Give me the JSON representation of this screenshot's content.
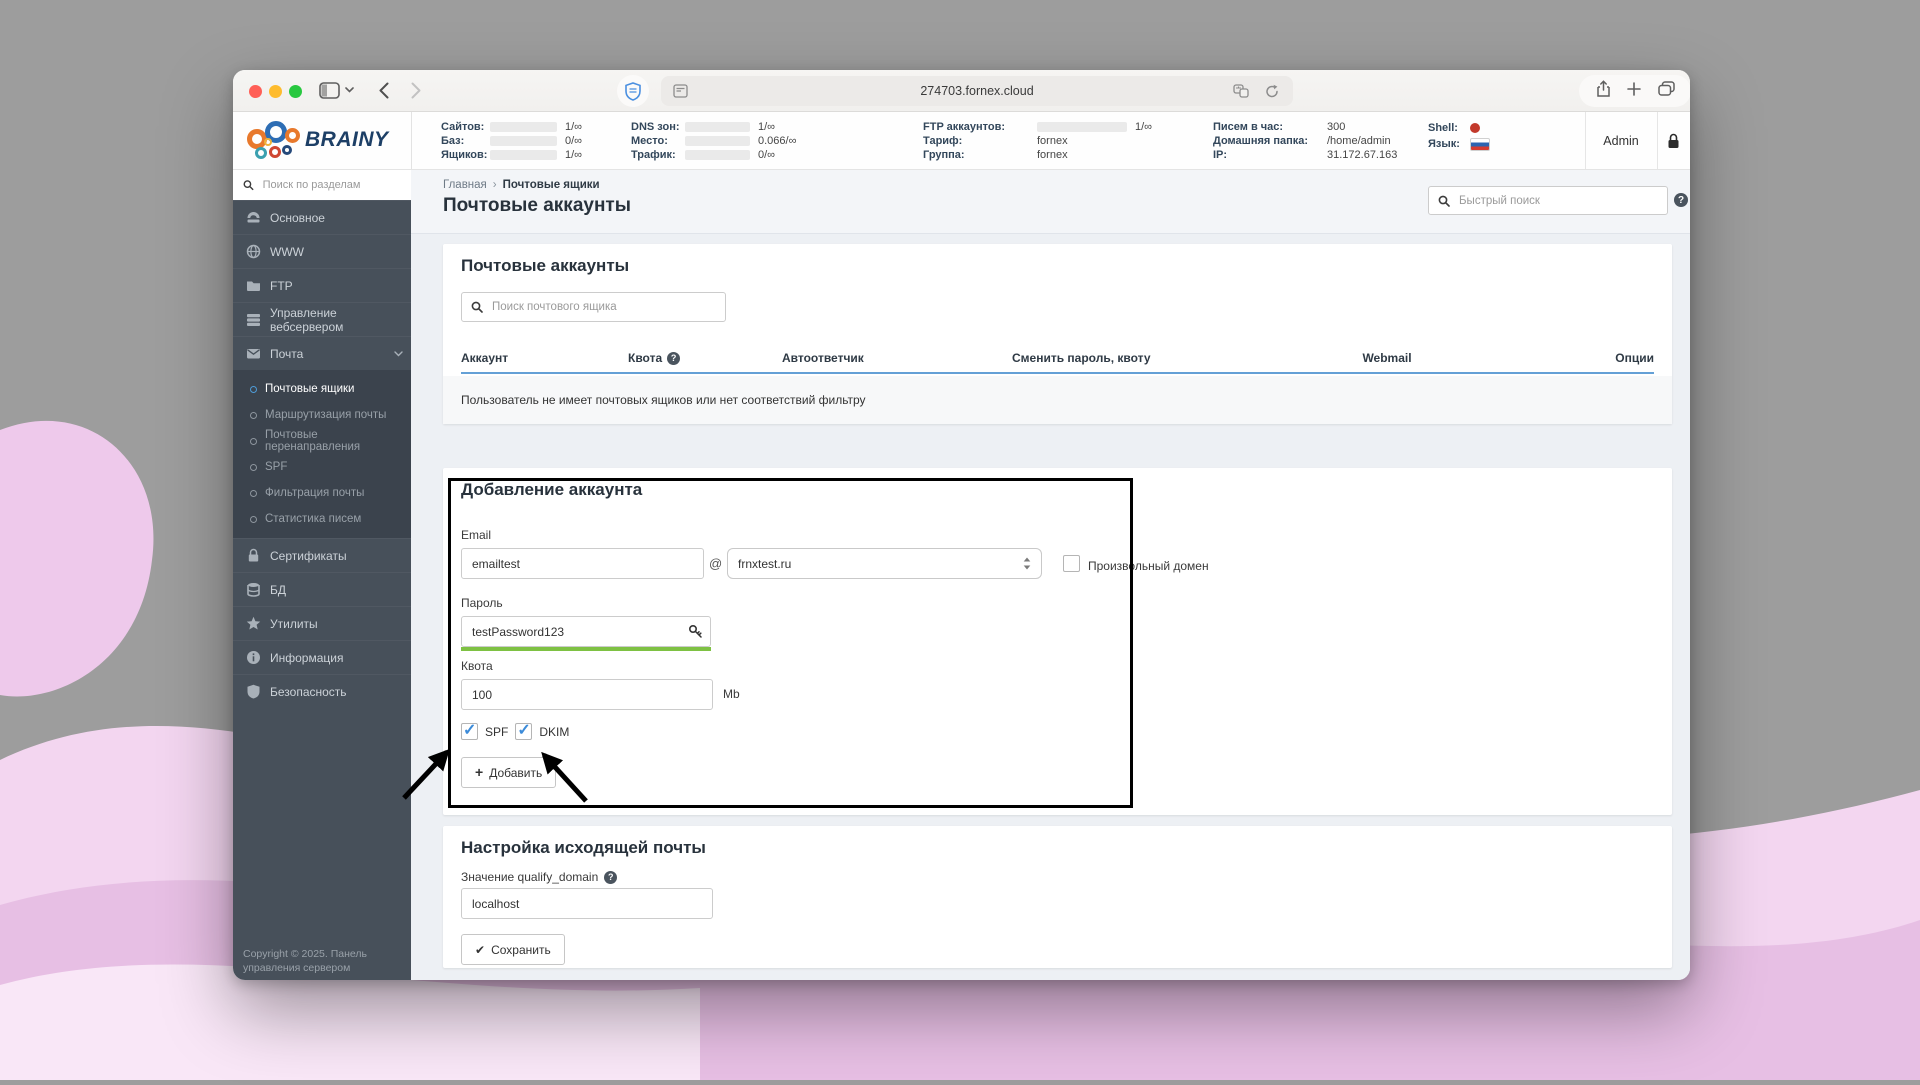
{
  "browser": {
    "url": "274703.fornex.cloud"
  },
  "statsbar": {
    "logo_text": "BRAINY",
    "user_label": "Admin",
    "columns": [
      {
        "rows": [
          {
            "label": "Сайтов:",
            "value": "1/∞"
          },
          {
            "label": "Баз:",
            "value": "0/∞"
          },
          {
            "label": "Ящиков:",
            "value": "1/∞"
          }
        ]
      },
      {
        "rows": [
          {
            "label": "DNS зон:",
            "value": "1/∞"
          },
          {
            "label": "Место:",
            "value": "0.066/∞"
          },
          {
            "label": "Трафик:",
            "value": "0/∞"
          }
        ]
      },
      {
        "rows": [
          {
            "label": "FTP аккаунтов:",
            "value": "1/∞"
          },
          {
            "label": "Тариф:",
            "value": "fornex"
          },
          {
            "label": "Группа:",
            "value": "fornex"
          }
        ]
      },
      {
        "rows": [
          {
            "label": "Писем в час:",
            "value": "300"
          },
          {
            "label": "Домашняя папка:",
            "value": "/home/admin"
          },
          {
            "label": "IP:",
            "value": "31.172.67.163"
          }
        ]
      },
      {
        "rows": [
          {
            "label": "Shell:",
            "value": ""
          },
          {
            "label": "Язык:",
            "value": ""
          }
        ]
      }
    ],
    "shell_status_color": "#c2392b"
  },
  "sidebar": {
    "search_placeholder": "Поиск по разделам",
    "items": [
      {
        "label": "Основное"
      },
      {
        "label": "WWW"
      },
      {
        "label": "FTP"
      },
      {
        "label": "Управление вебсервером"
      },
      {
        "label": "Почта"
      },
      {
        "label": "Сертификаты"
      },
      {
        "label": "БД"
      },
      {
        "label": "Утилиты"
      },
      {
        "label": "Информация"
      },
      {
        "label": "Безопасность"
      }
    ],
    "mail_subitems": [
      {
        "label": "Почтовые ящики",
        "active": true
      },
      {
        "label": "Маршрутизация почты"
      },
      {
        "label": "Почтовые перенаправления"
      },
      {
        "label": "SPF"
      },
      {
        "label": "Фильтрация почты"
      },
      {
        "label": "Статистика писем"
      }
    ],
    "copyright": "Copyright © 2025. Панель управления сервером"
  },
  "page": {
    "breadcrumb": [
      "Главная",
      "Почтовые ящики"
    ],
    "title": "Почтовые аккаунты",
    "quick_search_placeholder": "Быстрый поиск"
  },
  "accounts": {
    "heading": "Почтовые аккаунты",
    "search_placeholder": "Поиск почтового ящика",
    "columns": [
      "Аккаунт",
      "Квота",
      "Автоответчик",
      "Сменить пароль, квоту",
      "Webmail",
      "Опции"
    ],
    "empty_message": "Пользователь не имеет почтовых ящиков или нет соответствий фильтру"
  },
  "add_account": {
    "heading": "Добавление аккаунта",
    "email_label": "Email",
    "email_value": "emailtest",
    "at_symbol": "@",
    "domain_value": "frnxtest.ru",
    "custom_domain_label": "Произвольный домен",
    "custom_domain_checked": false,
    "password_label": "Пароль",
    "password_value": "testPassword123",
    "quota_label": "Квота",
    "quota_value": "100",
    "quota_unit": "Mb",
    "spf_label": "SPF",
    "spf_checked": true,
    "dkim_label": "DKIM",
    "dkim_checked": true,
    "submit_label": "Добавить"
  },
  "outgoing": {
    "heading": "Настройка исходящей почты",
    "qualify_label": "Значение qualify_domain",
    "qualify_value": "localhost",
    "save_label": "Сохранить"
  },
  "theme": {
    "accent_blue": "#4e9cd8",
    "success_green": "#7ec143",
    "table_header_border": "#64a0d6",
    "sidebar_bg": "#47505a",
    "annotation_color": "#000000"
  }
}
